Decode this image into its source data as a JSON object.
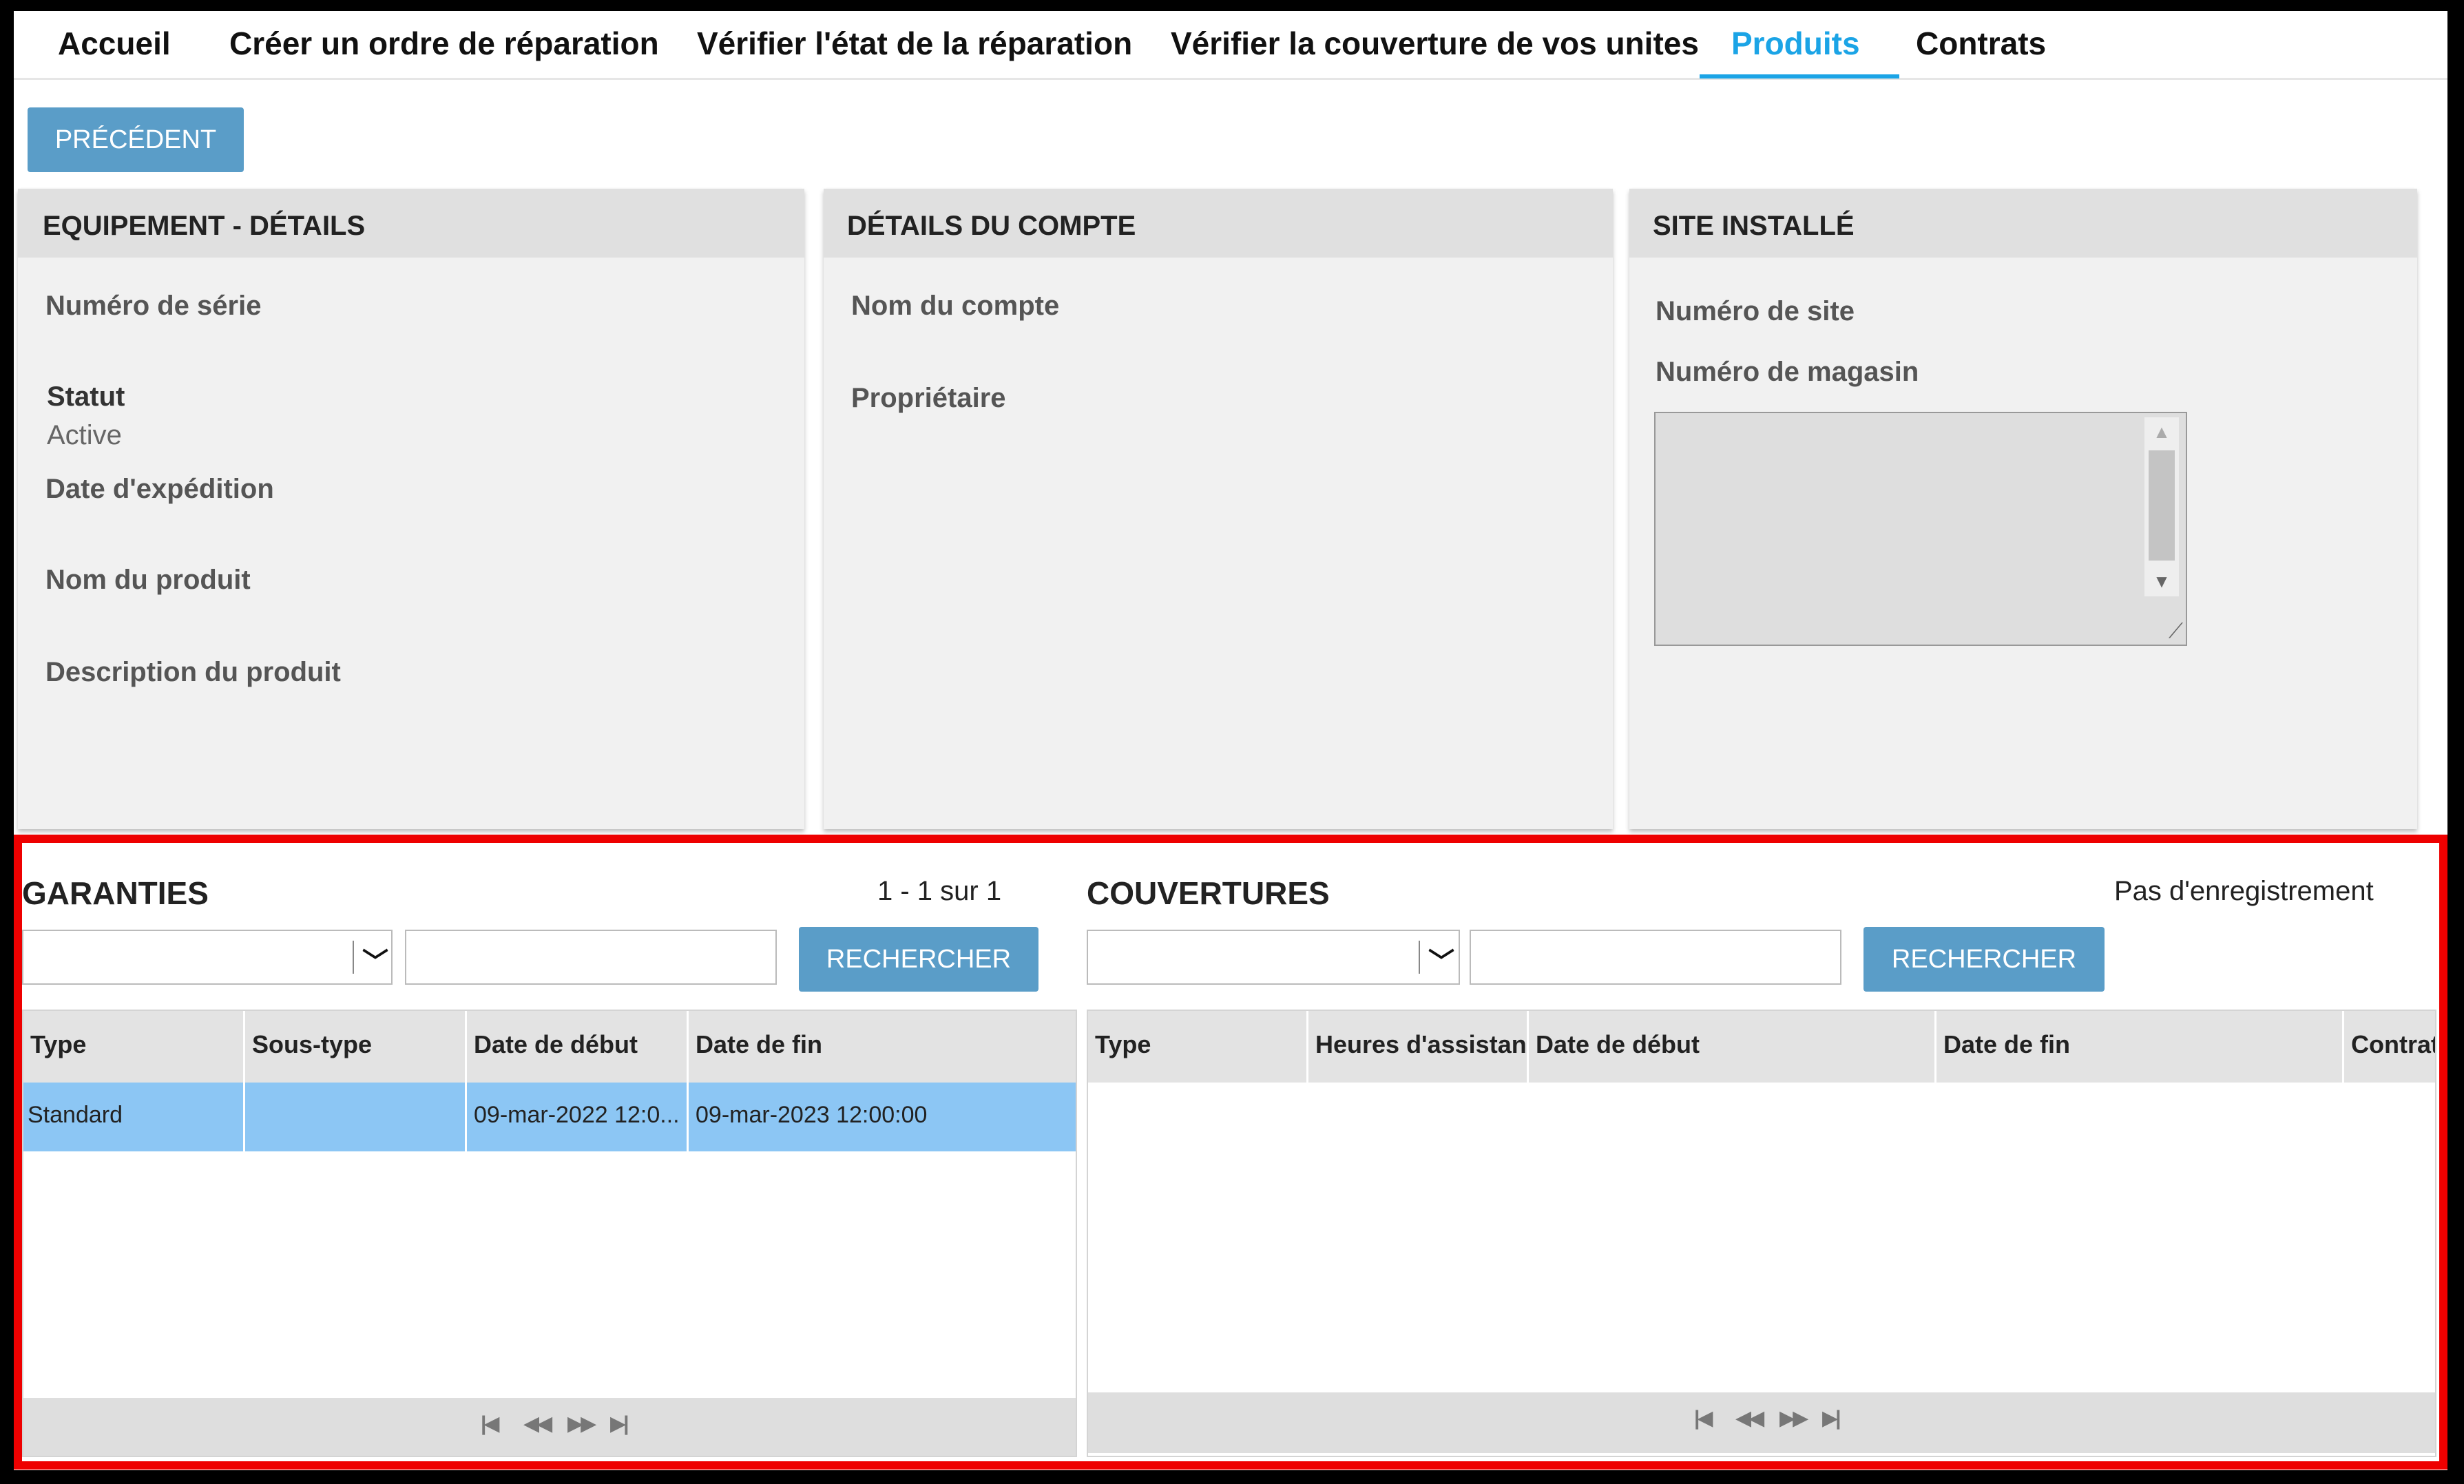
{
  "tabs": [
    "Accueil",
    "Créer un ordre de réparation",
    "Vérifier l'état de la réparation",
    "Vérifier la couverture de vos unites",
    "Produits",
    "Contrats"
  ],
  "active_tab": "Produits",
  "previous_button": "PRÉCÉDENT",
  "equipment": {
    "title": "EQUIPEMENT - DÉTAILS",
    "serial_label": "Numéro de série",
    "status_label": "Statut",
    "status_value": "Active",
    "ship_date_label": "Date d'expédition",
    "product_name_label": "Nom du produit",
    "product_desc_label": "Description du produit"
  },
  "account": {
    "title": "DÉTAILS DU COMPTE",
    "account_name_label": "Nom du compte",
    "owner_label": "Propriétaire"
  },
  "site": {
    "title": "SITE INSTALLÉ",
    "site_number_label": "Numéro de site",
    "store_number_label": "Numéro de magasin"
  },
  "warranties": {
    "title": "GARANTIES",
    "count": "1 - 1 sur 1",
    "search_button": "RECHERCHER",
    "columns": [
      "Type",
      "Sous-type",
      "Date de début",
      "Date de fin"
    ],
    "rows": [
      {
        "type": "Standard",
        "subtype": "",
        "start": "09-mar-2022 12:0...",
        "end": "09-mar-2023 12:00:00"
      }
    ]
  },
  "coverages": {
    "title": "COUVERTURES",
    "count": "Pas d'enregistrement",
    "search_button": "RECHERCHER",
    "columns": [
      "Type",
      "Heures d'assistanc",
      "Date de début",
      "Date de fin",
      "Contrat"
    ]
  },
  "pager_icons": [
    "first-page-icon",
    "prev-page-icon",
    "next-page-icon",
    "last-page-icon"
  ],
  "colors": {
    "accent": "#1ba4e6",
    "button": "#5a9dc8",
    "selected_row": "#8cc6f4",
    "highlight": "#ee0000"
  }
}
